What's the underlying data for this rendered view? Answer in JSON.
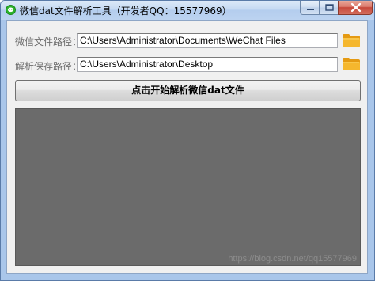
{
  "window": {
    "title": "微信dat文件解析工具（开发者QQ：15577969）"
  },
  "form": {
    "source_label": "微信文件路径：",
    "source_value": "C:\\Users\\Administrator\\Documents\\WeChat Files",
    "dest_label": "解析保存路径：",
    "dest_value": "C:\\Users\\Administrator\\Desktop",
    "start_button_label": "点击开始解析微信dat文件"
  },
  "watermark": "https://blog.csdn.net/qq15577969",
  "icons": {
    "app": "wechat-icon",
    "browse": "folder-icon"
  },
  "colors": {
    "folder": "#f5b72e",
    "output_bg": "#6b6b6b",
    "close_button": "#c7473a"
  }
}
